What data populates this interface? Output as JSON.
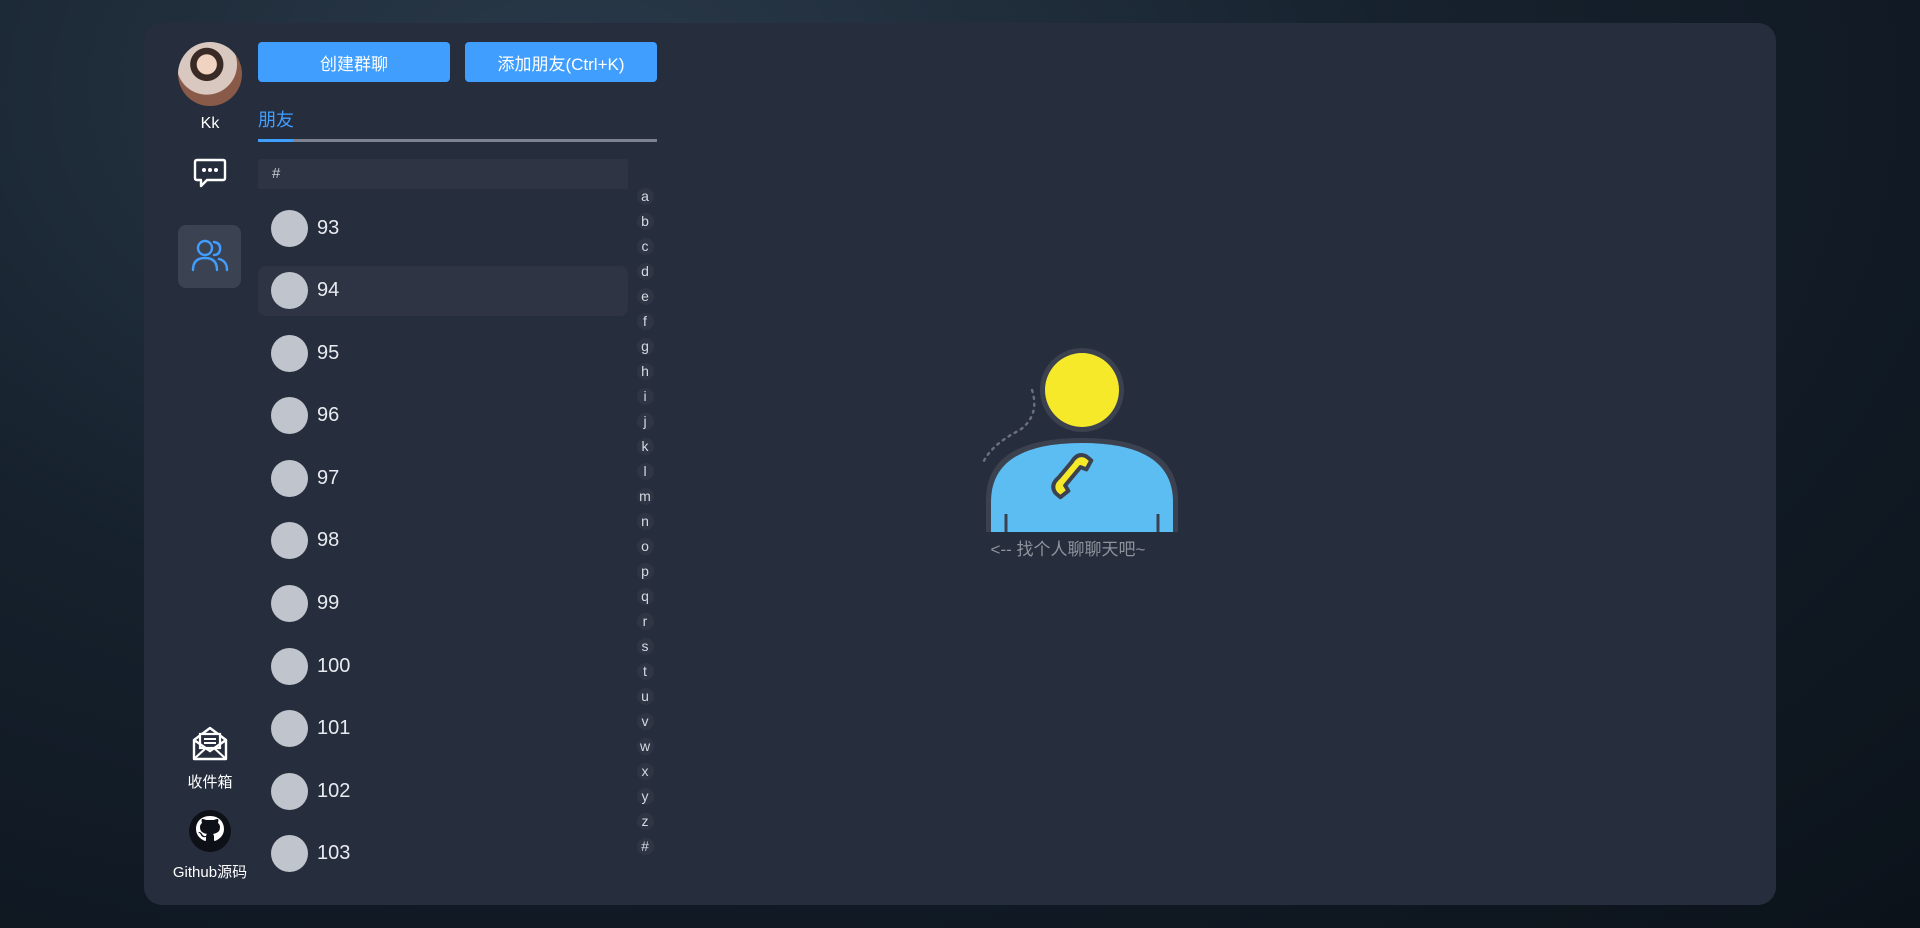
{
  "user": {
    "name": "Kk"
  },
  "toolbar": {
    "create_group_label": "创建群聊",
    "add_friend_label": "添加朋友(Ctrl+K)"
  },
  "tabs": [
    {
      "label": "朋友",
      "active": true
    }
  ],
  "list": {
    "group_header": "#",
    "friends": [
      {
        "name": "93"
      },
      {
        "name": "94"
      },
      {
        "name": "95"
      },
      {
        "name": "96"
      },
      {
        "name": "97"
      },
      {
        "name": "98"
      },
      {
        "name": "99"
      },
      {
        "name": "100"
      },
      {
        "name": "101"
      },
      {
        "name": "102"
      },
      {
        "name": "103"
      }
    ],
    "hovered_index": 1
  },
  "alphabet": [
    "a",
    "b",
    "c",
    "d",
    "e",
    "f",
    "g",
    "h",
    "i",
    "j",
    "k",
    "l",
    "m",
    "n",
    "o",
    "p",
    "q",
    "r",
    "s",
    "t",
    "u",
    "v",
    "w",
    "x",
    "y",
    "z",
    "#"
  ],
  "rail": {
    "inbox_label": "收件箱",
    "github_label": "Github源码"
  },
  "empty_state": {
    "text": "<-- 找个人聊聊天吧~"
  },
  "colors": {
    "accent": "#409eff",
    "panel": "#262d3d",
    "avatar_placeholder": "#c0c4cc"
  }
}
